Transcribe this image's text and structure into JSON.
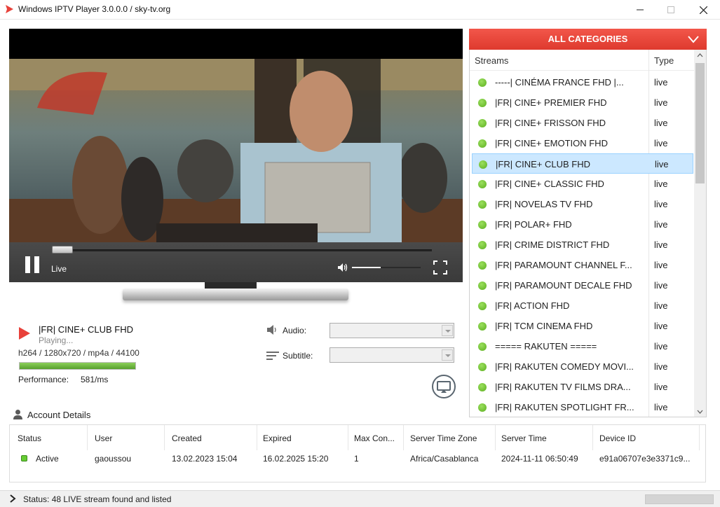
{
  "window": {
    "title": "Windows IPTV Player 3.0.0.0 / sky-tv.org",
    "controls": [
      "minimize-icon",
      "maximize-icon",
      "close-icon"
    ]
  },
  "player": {
    "live_label": "Live",
    "seek_progress": 0.0,
    "volume_level": 0.42,
    "icons": [
      "pause-icon",
      "volume-icon",
      "fullscreen-icon"
    ]
  },
  "now_playing": {
    "title": "|FR| CINE+ CLUB FHD",
    "state": "Playing...",
    "codec": "h264 / 1280x720 / mp4a / 44100",
    "performance_fraction": 1.0,
    "performance_label": "Performance:",
    "performance_value": "581/ms"
  },
  "options": {
    "audio_label": "Audio:",
    "audio_value": "",
    "subtitle_label": "Subtitle:",
    "subtitle_value": ""
  },
  "streams": {
    "category": "ALL CATEGORIES",
    "col_streams": "Streams",
    "col_type": "Type",
    "selected_index": 4,
    "accent": "#e3413a",
    "items": [
      {
        "name": "-----| CINÉMA FRANCE FHD |...",
        "type": "live"
      },
      {
        "name": "|FR| CINE+ PREMIER FHD",
        "type": "live"
      },
      {
        "name": "|FR| CINE+ FRISSON FHD",
        "type": "live"
      },
      {
        "name": "|FR| CINE+ EMOTION FHD",
        "type": "live"
      },
      {
        "name": "|FR| CINE+ CLUB FHD",
        "type": "live"
      },
      {
        "name": "|FR| CINE+ CLASSIC FHD",
        "type": "live"
      },
      {
        "name": "|FR| NOVELAS TV FHD",
        "type": "live"
      },
      {
        "name": "|FR| POLAR+ FHD",
        "type": "live"
      },
      {
        "name": "|FR| CRIME DISTRICT FHD",
        "type": "live"
      },
      {
        "name": "|FR| PARAMOUNT CHANNEL F...",
        "type": "live"
      },
      {
        "name": "|FR| PARAMOUNT DECALE FHD",
        "type": "live"
      },
      {
        "name": "|FR| ACTION FHD",
        "type": "live"
      },
      {
        "name": "|FR| TCM CINEMA FHD",
        "type": "live"
      },
      {
        "name": "===== RAKUTEN =====",
        "type": "live"
      },
      {
        "name": "|FR| RAKUTEN COMEDY MOVI...",
        "type": "live"
      },
      {
        "name": "|FR| RAKUTEN TV FILMS DRA...",
        "type": "live"
      },
      {
        "name": "|FR| RAKUTEN SPOTLIGHT FR...",
        "type": "live"
      }
    ]
  },
  "account": {
    "title": "Account Details",
    "columns": [
      {
        "label": "Status",
        "value": "Active"
      },
      {
        "label": "User",
        "value": "gaoussou"
      },
      {
        "label": "Created",
        "value": "13.02.2023 15:04"
      },
      {
        "label": "Expired",
        "value": "16.02.2025 15:20"
      },
      {
        "label": "Max Con...",
        "value": "1"
      },
      {
        "label": "Server Time Zone",
        "value": "Africa/Casablanca"
      },
      {
        "label": "Server Time",
        "value": "2024-11-11 06:50:49"
      },
      {
        "label": "Device ID",
        "value": "e91a06707e3e3371c9..."
      }
    ]
  },
  "statusbar": {
    "text": "Status: 48 LIVE stream found and listed"
  }
}
